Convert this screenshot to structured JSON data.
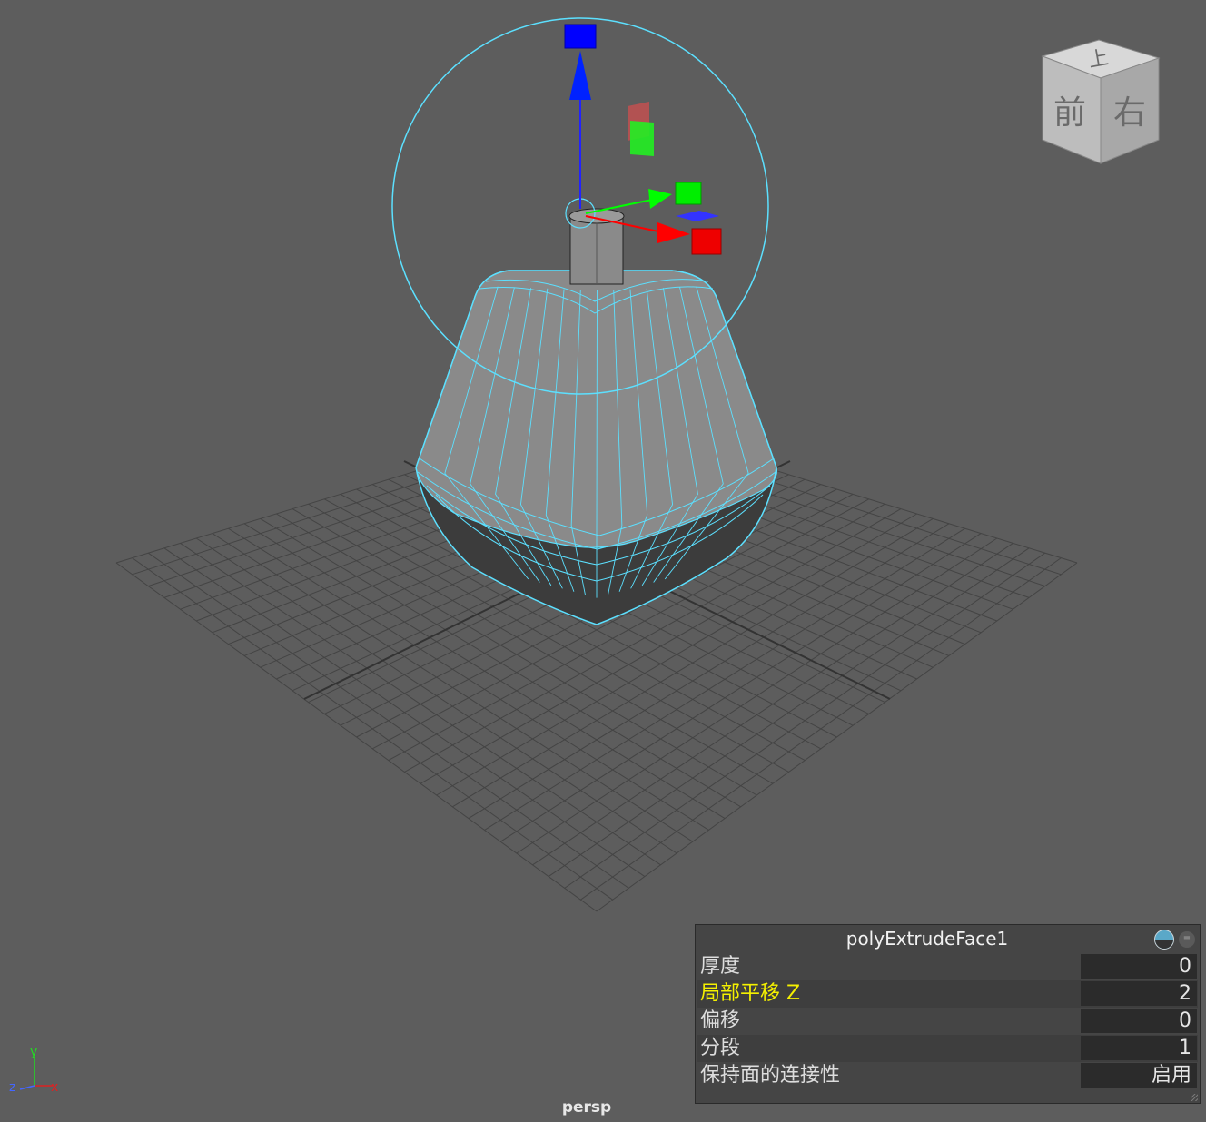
{
  "viewport": {
    "camera_label": "persp",
    "view_cube": {
      "top": "上",
      "front": "前",
      "right": "右"
    },
    "axis_triad": {
      "x": "x",
      "y": "y",
      "z": "z"
    }
  },
  "attribute_box": {
    "title": "polyExtrudeFace1",
    "rows": [
      {
        "label": "厚度",
        "value": "0"
      },
      {
        "label": "局部平移 Z",
        "value": "2"
      },
      {
        "label": "偏移",
        "value": "0"
      },
      {
        "label": "分段",
        "value": "1"
      },
      {
        "label": "保持面的连接性",
        "value": "启用"
      }
    ]
  },
  "colors": {
    "background": "#5d5d5d",
    "wireframe": "#5ce0ff",
    "x_axis": "#ff0000",
    "y_axis": "#00ff00",
    "z_axis": "#0000ff",
    "highlight_label": "#f4f000"
  }
}
